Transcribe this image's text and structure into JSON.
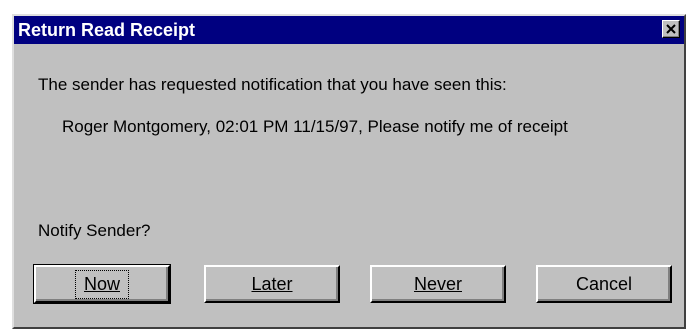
{
  "clipped_text": "wrapped text cropped at top",
  "dialog": {
    "title": "Return Read Receipt",
    "message": "The sender has requested notification that you have seen this:",
    "detail": "Roger Montgomery, 02:01 PM 11/15/97, Please notify me of receipt",
    "question": "Notify Sender?",
    "close_icon": "close-x-icon"
  },
  "buttons": {
    "now": "Now",
    "later": "Later",
    "never": "Never",
    "cancel": "Cancel"
  },
  "colors": {
    "titlebar": "#000080",
    "face": "#c0c0c0"
  }
}
